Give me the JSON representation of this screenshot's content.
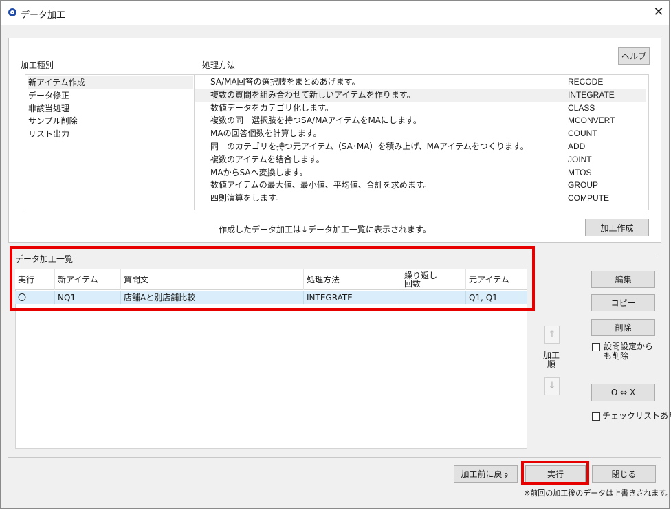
{
  "window": {
    "title": "データ加工",
    "close_glyph": "✕"
  },
  "help_button": "ヘルプ",
  "processing_type": {
    "label": "加工種別",
    "items": [
      "新アイテム作成",
      "データ修正",
      "非該当処理",
      "サンプル削除",
      "リスト出力"
    ],
    "selected_index": 0
  },
  "processing_method": {
    "label": "処理方法",
    "selected_index": 1,
    "rows": [
      {
        "desc": "SA/MA回答の選択肢をまとめあげます。",
        "code": "RECODE"
      },
      {
        "desc": "複数の質問を組み合わせて新しいアイテムを作ります。",
        "code": "INTEGRATE"
      },
      {
        "desc": "数値データをカテゴリ化します。",
        "code": "CLASS"
      },
      {
        "desc": "複数の同一選択肢を持つSA/MAアイテムをMAにします。",
        "code": "MCONVERT"
      },
      {
        "desc": "MAの回答個数を計算します。",
        "code": "COUNT"
      },
      {
        "desc": "同一のカテゴリを持つ元アイテム（SA･MA）を積み上げ、MAアイテムをつくります。",
        "code": "ADD"
      },
      {
        "desc": "複数のアイテムを結合します。",
        "code": "JOINT"
      },
      {
        "desc": "MAからSAへ変換します。",
        "code": "MTOS"
      },
      {
        "desc": "数値アイテムの最大値、最小値、平均値、合計を求めます。",
        "code": "GROUP"
      },
      {
        "desc": "四則演算をします。",
        "code": "COMPUTE"
      }
    ]
  },
  "info_text": "作成したデータ加工は↓データ加工一覧に表示されます。",
  "create_button": "加工作成",
  "list": {
    "title": "データ加工一覧",
    "headers": {
      "execute": "実行",
      "new_item": "新アイテム",
      "question": "質問文",
      "method": "処理方法",
      "repeat_line1": "繰り返し",
      "repeat_line2": "回数",
      "source": "元アイテム"
    },
    "rows": [
      {
        "execute": "〇",
        "new_item": "NQ1",
        "question": "店舗Aと別店舗比較",
        "method": "INTEGRATE",
        "repeat": "",
        "source": "Q1, Q1"
      }
    ]
  },
  "side": {
    "edit": "編集",
    "copy": "コピー",
    "delete": "削除",
    "delete_from_setting": "設問設定からも削除",
    "order_label": "加工順",
    "up_glyph": "↑",
    "down_glyph": "↓",
    "toggle": "O ⇔ X",
    "checklist": "チェックリストあり"
  },
  "footer": {
    "revert": "加工前に戻す",
    "execute": "実行",
    "close": "閉じる",
    "note": "※前回の加工後のデータは上書きされます。"
  },
  "colors": {
    "highlight_frame": "#e60000",
    "selected_row": "#d9eefa"
  }
}
